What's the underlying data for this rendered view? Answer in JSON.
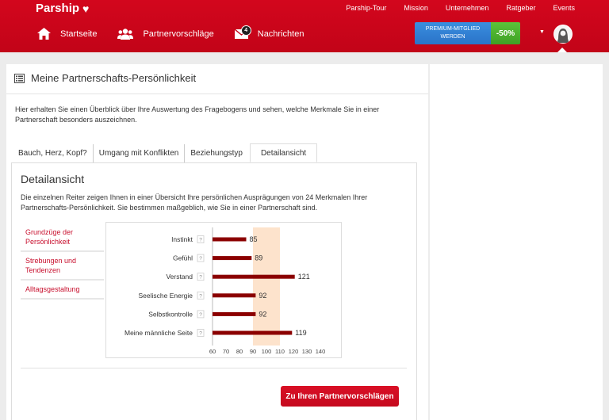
{
  "header": {
    "logo": "Parship",
    "top_links": [
      "Parship-Tour",
      "Mission",
      "Unternehmen",
      "Ratgeber",
      "Events"
    ],
    "nav": {
      "home": "Startseite",
      "partners": "Partnervorschläge",
      "messages": "Nachrichten",
      "messages_badge": "4"
    },
    "premium": {
      "line1": "PREMIUM-MITGLIED",
      "line2": "WERDEN",
      "discount": "-50%"
    },
    "colors": {
      "brand": "#c8102e",
      "premium_blue": "#2f80d6",
      "premium_green": "#4cb52f"
    }
  },
  "page": {
    "title": "Meine Partnerschafts-Persönlichkeit",
    "intro": "Hier erhalten Sie einen Überblick über Ihre Auswertung des Fragebogens und sehen, welche Merkmale Sie in einer Partnerschaft besonders auszeichnen.",
    "tabs": [
      "Bauch, Herz, Kopf?",
      "Umgang mit Konflikten",
      "Beziehungstyp",
      "Detailansicht"
    ],
    "active_tab": "Detailansicht",
    "detail_title": "Detailansicht",
    "detail_desc": "Die einzelnen Reiter zeigen Ihnen in einer Übersicht Ihre persönlichen Ausprägungen von 24 Merkmalen Ihrer Partnerschafts-Persönlichkeit. Sie bestimmen maßgeblich, wie Sie in einer Partnerschaft sind.",
    "subnav": [
      "Grundzüge der Persönlichkeit",
      "Strebungen und Tendenzen",
      "Alltagsgestaltung"
    ],
    "help_mark": "?",
    "cta": "Zu Ihren Partnervorschlägen"
  },
  "chart_data": {
    "type": "bar",
    "orientation": "horizontal",
    "categories": [
      "Instinkt",
      "Gefühl",
      "Verstand",
      "Seelische Energie",
      "Selbstkontrolle",
      "Meine männliche Seite"
    ],
    "values": [
      85,
      89,
      121,
      92,
      92,
      119
    ],
    "xlim": [
      60,
      140
    ],
    "xticks": [
      60,
      70,
      80,
      90,
      100,
      110,
      120,
      130,
      140
    ],
    "highlight_range": [
      90,
      110
    ],
    "bar_color": "#8b0000",
    "highlight_color": "#fde3cc",
    "data_labels": true,
    "grid": false
  }
}
